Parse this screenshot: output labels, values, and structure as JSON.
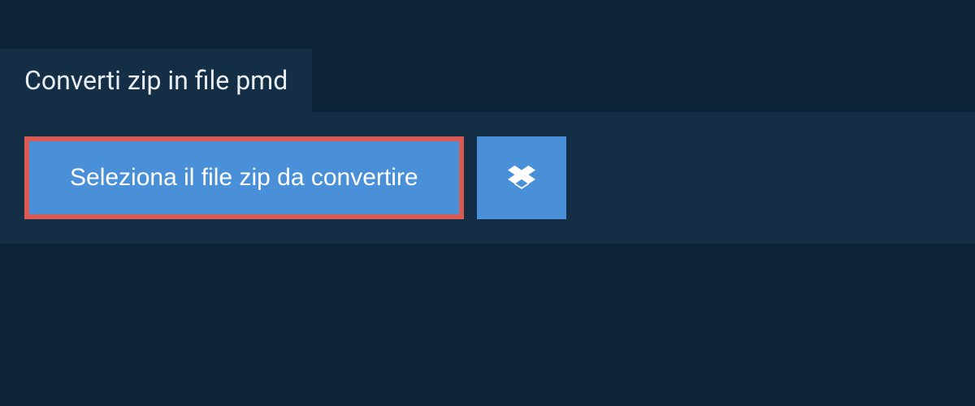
{
  "header": {
    "title": "Converti zip in file pmd"
  },
  "actions": {
    "select_file_label": "Seleziona il file zip da convertire"
  },
  "colors": {
    "page_bg": "#0d2438",
    "panel_bg": "#132e45",
    "button_bg": "#4a90d9",
    "highlight_border": "#d85a52",
    "text_light": "#e8eef3",
    "text_white": "#ffffff"
  }
}
